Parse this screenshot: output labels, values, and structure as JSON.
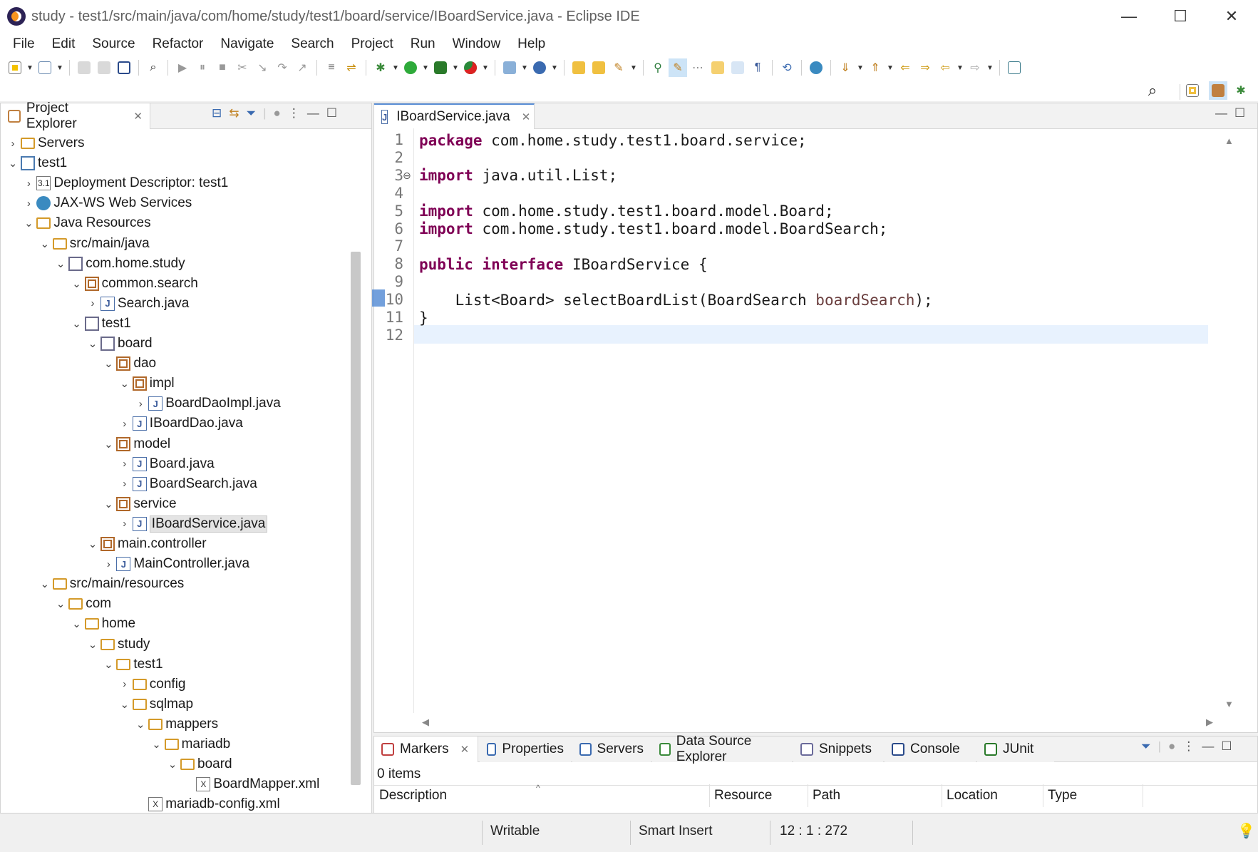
{
  "window": {
    "title": "study - test1/src/main/java/com/home/study/test1/board/service/IBoardService.java - Eclipse IDE",
    "controls": {
      "minimize": "—",
      "maximize": "☐",
      "close": "✕"
    }
  },
  "menubar": [
    "File",
    "Edit",
    "Source",
    "Refactor",
    "Navigate",
    "Search",
    "Project",
    "Run",
    "Window",
    "Help"
  ],
  "project_explorer": {
    "title": "Project Explorer",
    "tree": [
      {
        "label": "Servers",
        "icon": "folder-icon",
        "toggle": "›",
        "depth": 0
      },
      {
        "label": "test1",
        "icon": "project-icon",
        "toggle": "⌄",
        "depth": 0
      },
      {
        "label": "Deployment Descriptor: test1",
        "icon": "deployment-descriptor-icon",
        "toggle": "›",
        "depth": 1
      },
      {
        "label": "JAX-WS Web Services",
        "icon": "web-services-icon",
        "toggle": "›",
        "depth": 1
      },
      {
        "label": "Java Resources",
        "icon": "java-resources-icon",
        "toggle": "⌄",
        "depth": 1
      },
      {
        "label": "src/main/java",
        "icon": "source-folder-icon",
        "toggle": "⌄",
        "depth": 2
      },
      {
        "label": "com.home.study",
        "icon": "empty-package-icon",
        "toggle": "⌄",
        "depth": 3
      },
      {
        "label": "common.search",
        "icon": "package-icon",
        "toggle": "⌄",
        "depth": 4
      },
      {
        "label": "Search.java",
        "icon": "java-file-icon",
        "toggle": "›",
        "depth": 5
      },
      {
        "label": "test1",
        "icon": "empty-package-icon",
        "toggle": "⌄",
        "depth": 4
      },
      {
        "label": "board",
        "icon": "empty-package-icon",
        "toggle": "⌄",
        "depth": 5
      },
      {
        "label": "dao",
        "icon": "package-icon",
        "toggle": "⌄",
        "depth": 6
      },
      {
        "label": "impl",
        "icon": "package-icon",
        "toggle": "⌄",
        "depth": 7
      },
      {
        "label": "BoardDaoImpl.java",
        "icon": "java-file-icon",
        "toggle": "›",
        "depth": 8
      },
      {
        "label": "IBoardDao.java",
        "icon": "java-interface-file-icon",
        "toggle": "›",
        "depth": 7
      },
      {
        "label": "model",
        "icon": "package-icon",
        "toggle": "⌄",
        "depth": 6
      },
      {
        "label": "Board.java",
        "icon": "java-file-icon",
        "toggle": "›",
        "depth": 7
      },
      {
        "label": "BoardSearch.java",
        "icon": "java-file-icon",
        "toggle": "›",
        "depth": 7
      },
      {
        "label": "service",
        "icon": "package-icon",
        "toggle": "⌄",
        "depth": 6
      },
      {
        "label": "IBoardService.java",
        "icon": "java-interface-file-icon",
        "toggle": "›",
        "depth": 7,
        "selected": true
      },
      {
        "label": "main.controller",
        "icon": "package-icon",
        "toggle": "⌄",
        "depth": 5
      },
      {
        "label": "MainController.java",
        "icon": "java-file-icon",
        "toggle": "›",
        "depth": 6
      },
      {
        "label": "src/main/resources",
        "icon": "source-folder-icon",
        "toggle": "⌄",
        "depth": 2
      },
      {
        "label": "com",
        "icon": "folder-icon",
        "toggle": "⌄",
        "depth": 3
      },
      {
        "label": "home",
        "icon": "folder-icon",
        "toggle": "⌄",
        "depth": 4
      },
      {
        "label": "study",
        "icon": "folder-icon",
        "toggle": "⌄",
        "depth": 5
      },
      {
        "label": "test1",
        "icon": "folder-icon",
        "toggle": "⌄",
        "depth": 6
      },
      {
        "label": "config",
        "icon": "folder-icon",
        "toggle": "›",
        "depth": 7
      },
      {
        "label": "sqlmap",
        "icon": "folder-icon",
        "toggle": "⌄",
        "depth": 7
      },
      {
        "label": "mappers",
        "icon": "folder-icon",
        "toggle": "⌄",
        "depth": 8
      },
      {
        "label": "mariadb",
        "icon": "folder-icon",
        "toggle": "⌄",
        "depth": 9
      },
      {
        "label": "board",
        "icon": "folder-icon",
        "toggle": "⌄",
        "depth": 10
      },
      {
        "label": "BoardMapper.xml",
        "icon": "xml-file-icon",
        "toggle": "",
        "depth": 11
      },
      {
        "label": "mariadb-config.xml",
        "icon": "xml-file-icon",
        "toggle": "",
        "depth": 8
      }
    ]
  },
  "editor": {
    "tab_label": "IBoardService.java",
    "lines": [
      {
        "n": "1",
        "parts": [
          {
            "t": "package",
            "k": "kw"
          },
          {
            "t": " com.home.study.test1.board.service;",
            "k": ""
          }
        ]
      },
      {
        "n": "2",
        "parts": []
      },
      {
        "n": "3",
        "parts": [
          {
            "t": "import",
            "k": "kw"
          },
          {
            "t": " java.util.List;",
            "k": ""
          }
        ]
      },
      {
        "n": "4",
        "parts": []
      },
      {
        "n": "5",
        "parts": [
          {
            "t": "import",
            "k": "kw"
          },
          {
            "t": " com.home.study.test1.board.model.Board;",
            "k": ""
          }
        ]
      },
      {
        "n": "6",
        "parts": [
          {
            "t": "import",
            "k": "kw"
          },
          {
            "t": " com.home.study.test1.board.model.BoardSearch;",
            "k": ""
          }
        ]
      },
      {
        "n": "7",
        "parts": []
      },
      {
        "n": "8",
        "parts": [
          {
            "t": "public",
            "k": "kw"
          },
          {
            "t": " ",
            "k": ""
          },
          {
            "t": "interface",
            "k": "kw"
          },
          {
            "t": " IBoardService {",
            "k": ""
          }
        ]
      },
      {
        "n": "9",
        "parts": []
      },
      {
        "n": "10",
        "parts": [
          {
            "t": "    List<Board> selectBoardList(BoardSearch ",
            "k": ""
          },
          {
            "t": "boardSearch",
            "k": "param"
          },
          {
            "t": ");",
            "k": ""
          }
        ]
      },
      {
        "n": "11",
        "parts": [
          {
            "t": "}",
            "k": ""
          }
        ]
      },
      {
        "n": "12",
        "parts": []
      }
    ]
  },
  "bottom_panel": {
    "tabs": [
      {
        "label": "Markers",
        "icon": "markers-icon",
        "active": true
      },
      {
        "label": "Properties",
        "icon": "properties-icon"
      },
      {
        "label": "Servers",
        "icon": "servers-icon"
      },
      {
        "label": "Data Source Explorer",
        "icon": "data-source-icon"
      },
      {
        "label": "Snippets",
        "icon": "snippets-icon"
      },
      {
        "label": "Console",
        "icon": "console-icon"
      },
      {
        "label": "JUnit",
        "icon": "junit-icon"
      }
    ],
    "items_count": "0 items",
    "columns": [
      "Description",
      "Resource",
      "Path",
      "Location",
      "Type"
    ]
  },
  "status_bar": {
    "writable": "Writable",
    "insert_mode": "Smart Insert",
    "position": "12 : 1 : 272"
  },
  "colors": {
    "keyword": "#7f0055",
    "parameter": "#6a3e3e",
    "current_line": "#e8f2fe",
    "accent": "#5b8fd6"
  }
}
